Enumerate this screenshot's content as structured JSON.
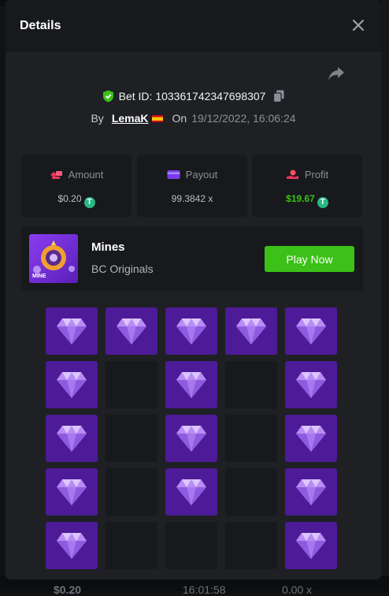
{
  "modal": {
    "title": "Details",
    "bet_id_label": "Bet ID:",
    "bet_id": "103361742347698307",
    "by_label": "By",
    "username": "LemaK",
    "on_label": "On",
    "datetime": "19/12/2022, 16:06:24"
  },
  "stats": {
    "amount": {
      "label": "Amount",
      "value": "$0.20",
      "icon": "amount-icon"
    },
    "payout": {
      "label": "Payout",
      "value": "99.3842 x",
      "icon": "payout-icon"
    },
    "profit": {
      "label": "Profit",
      "value": "$19.67",
      "icon": "profit-icon"
    }
  },
  "game": {
    "name": "Mines",
    "provider": "BC Originals",
    "thumbnail_text": "MINE",
    "play_button": "Play Now"
  },
  "board": {
    "rows": [
      [
        "gem",
        "gem",
        "gem",
        "gem",
        "gem"
      ],
      [
        "gem",
        "empty",
        "gem",
        "empty",
        "gem"
      ],
      [
        "gem",
        "empty",
        "gem",
        "empty",
        "gem"
      ],
      [
        "gem",
        "empty",
        "gem",
        "empty",
        "gem"
      ],
      [
        "gem",
        "empty",
        "empty",
        "empty",
        "gem"
      ]
    ]
  },
  "background": {
    "bottom_amount": "$0.20",
    "bottom_time": "16:01:58",
    "bottom_payout": "0.00 x"
  },
  "colors": {
    "accent_green": "#3bc117",
    "gem_tile": "#4d1b97",
    "empty_tile": "#17191c",
    "coin": "#29b883",
    "verified_shield": "#3bc117"
  }
}
